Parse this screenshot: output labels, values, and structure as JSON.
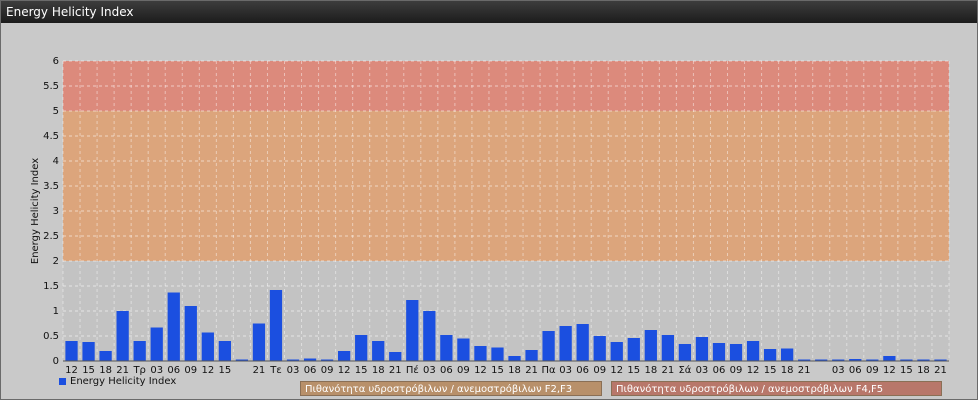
{
  "window": {
    "title": "Energy Helicity Index"
  },
  "legend": {
    "label": "Energy Helicity Index"
  },
  "zones": [
    {
      "label": "Πιθανότητα υδροστρόβιλων / ανεμοστρόβιλων F2,F3",
      "from": 2,
      "to": 5,
      "color": "#e0a070"
    },
    {
      "label": "Πιθανότητα υδροστρόβιλων / ανεμοστρόβιλων F4,F5",
      "from": 5,
      "to": 6,
      "color": "#e08070"
    }
  ],
  "chart_data": {
    "type": "bar",
    "title": "",
    "xlabel": "",
    "ylabel": "Energy Helicity Index",
    "ylim": [
      0,
      6
    ],
    "yticks": [
      "0",
      "0.5",
      "1",
      "1.5",
      "2",
      "2.5",
      "3",
      "3.5",
      "4",
      "4.5",
      "5",
      "5.5",
      "6"
    ],
    "grid": true,
    "bar_color": "#1b4fe0",
    "categories": [
      "12",
      "15",
      "18",
      "21",
      "Τρ",
      "03",
      "06",
      "09",
      "12",
      "15",
      "",
      "21",
      "Τε",
      "03",
      "06",
      "09",
      "12",
      "15",
      "18",
      "21",
      "Πέ",
      "03",
      "06",
      "09",
      "12",
      "15",
      "18",
      "21",
      "Πα",
      "03",
      "06",
      "09",
      "12",
      "15",
      "18",
      "21",
      "Σά",
      "03",
      "06",
      "09",
      "12",
      "15",
      "18",
      "21",
      "",
      "03",
      "06",
      "09",
      "12",
      "15",
      "18",
      "21"
    ],
    "series": [
      {
        "values": [
          0.4,
          0.38,
          0.2,
          1.0,
          0.4,
          0.67,
          1.37,
          1.1,
          0.57,
          0.4,
          0.03,
          0.75,
          1.42,
          0.03,
          0.05,
          0.03,
          0.2,
          0.52,
          0.4,
          0.18,
          1.22,
          1.0,
          0.52,
          0.45,
          0.3,
          0.27,
          0.1,
          0.22,
          0.6,
          0.7,
          0.74,
          0.5,
          0.38,
          0.46,
          0.62,
          0.52,
          0.34,
          0.48,
          0.36,
          0.34,
          0.4,
          0.24,
          0.25,
          0.03,
          0.03,
          0.03,
          0.04,
          0.03,
          0.1,
          0.03,
          0.03,
          0.03
        ]
      }
    ]
  }
}
